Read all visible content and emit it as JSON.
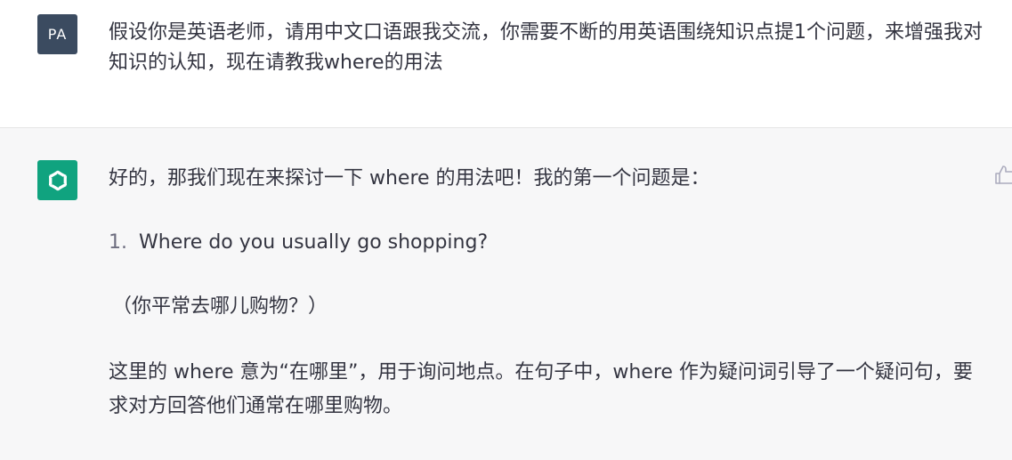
{
  "user": {
    "avatar_text": "PA",
    "message": "假设你是英语老师，请用中文口语跟我交流，你需要不断的用英语围绕知识点提1个问题，来增强我对知识的认知，现在请教我where的用法"
  },
  "assistant": {
    "avatar_icon": "openai-logo-icon",
    "intro": "好的，那我们现在来探讨一下 where 的用法吧！我的第一个问题是：",
    "list": [
      {
        "num": "1.",
        "text": "Where do you usually go shopping?"
      }
    ],
    "translation": "（你平常去哪儿购物？）",
    "explanation": "这里的 where 意为“在哪里”，用于询问地点。在句子中，where 作为疑问词引导了一个疑问句，要求对方回答他们通常在哪里购物。",
    "feedback_icon": "thumbs-up-icon"
  },
  "colors": {
    "user_avatar_bg": "#3b4b60",
    "bot_avatar_bg": "#10a37f",
    "assistant_row_bg": "#f7f7f8",
    "text": "#343541"
  }
}
